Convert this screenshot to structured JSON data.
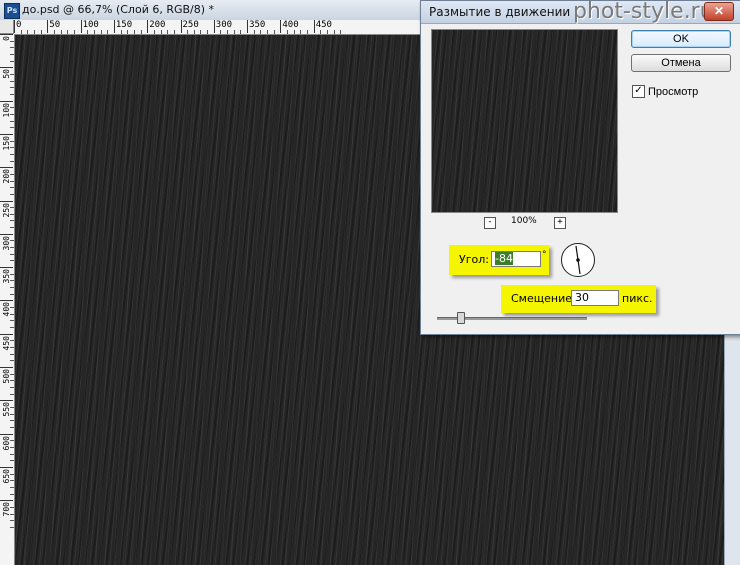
{
  "document": {
    "title": "до.psd @ 66,7% (Слой 6, RGB/8) *",
    "app_icon": "Ps",
    "ruler_top_labels": [
      "0",
      "50",
      "100",
      "150",
      "200",
      "250",
      "300",
      "350",
      "400",
      "450"
    ],
    "ruler_left_labels": [
      "0",
      "50",
      "100",
      "150",
      "200",
      "250",
      "300",
      "350",
      "400",
      "450",
      "500",
      "550",
      "600",
      "650",
      "700"
    ]
  },
  "watermark": "phot-style.ru",
  "dialog": {
    "title": "Размытие в движении",
    "ok_label": "OK",
    "cancel_label": "Отмена",
    "preview_label": "Просмотр",
    "preview_checked": "✓",
    "zoom_out": "-",
    "zoom_in": "+",
    "zoom_level": "100%",
    "angle_label": "Угол:",
    "angle_value": "-84",
    "angle_unit": "°",
    "distance_label": "Смещение:",
    "distance_value": "30",
    "distance_unit": "пикс."
  },
  "colors": {
    "highlight": "#f5f500",
    "canvas": "#1a1a1a"
  }
}
